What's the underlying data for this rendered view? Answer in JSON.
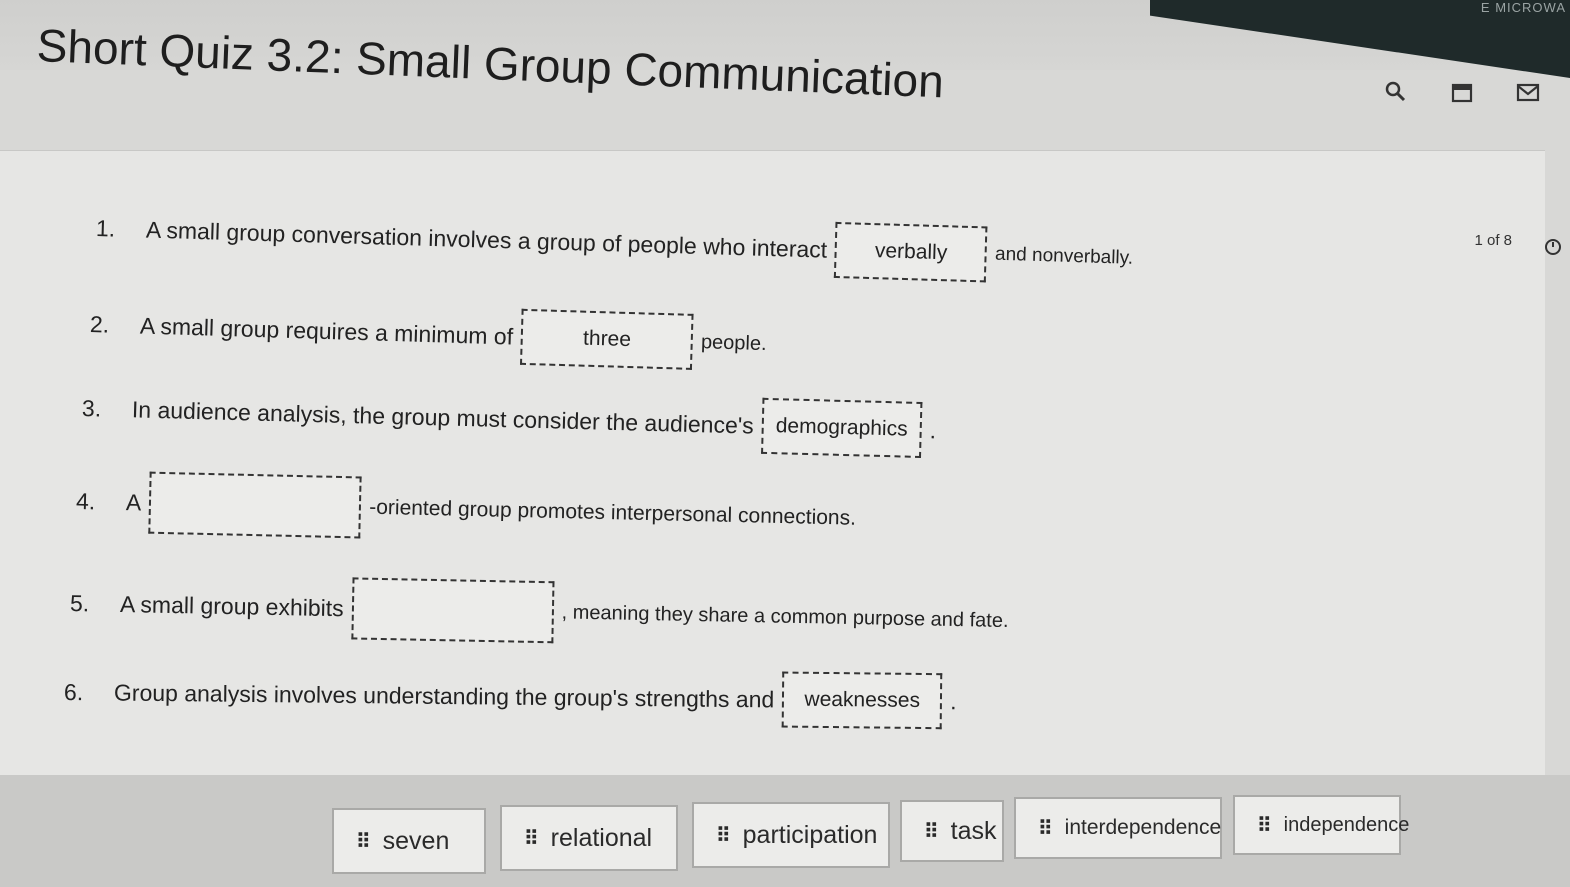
{
  "header": {
    "title": "Short Quiz 3.2: Small Group Communication",
    "brand": "E MICROWA"
  },
  "toolbar": {
    "icons": [
      "search-icon",
      "calendar-icon",
      "mail-icon"
    ]
  },
  "counter": "1 of 8",
  "questions": [
    {
      "num": "1.",
      "before": "A small group conversation involves a group of people who interact",
      "answer": "verbally",
      "after": "and nonverbally."
    },
    {
      "num": "2.",
      "before": "A small group requires a minimum of",
      "answer": "three",
      "after": "people."
    },
    {
      "num": "3.",
      "before": "In audience analysis, the group must consider the audience's",
      "answer": "demographics",
      "after": "."
    },
    {
      "num": "4.",
      "before": "A",
      "answer": "",
      "after": "-oriented group promotes interpersonal connections."
    },
    {
      "num": "5.",
      "before": "A small group exhibits",
      "answer": "",
      "after": ", meaning they share a common purpose and fate."
    },
    {
      "num": "6.",
      "before": "Group analysis involves understanding the group's strengths and",
      "answer": "weaknesses",
      "after": "."
    }
  ],
  "answer_bank": [
    "seven",
    "relational",
    "participation",
    "task",
    "interdependence",
    "independence"
  ]
}
